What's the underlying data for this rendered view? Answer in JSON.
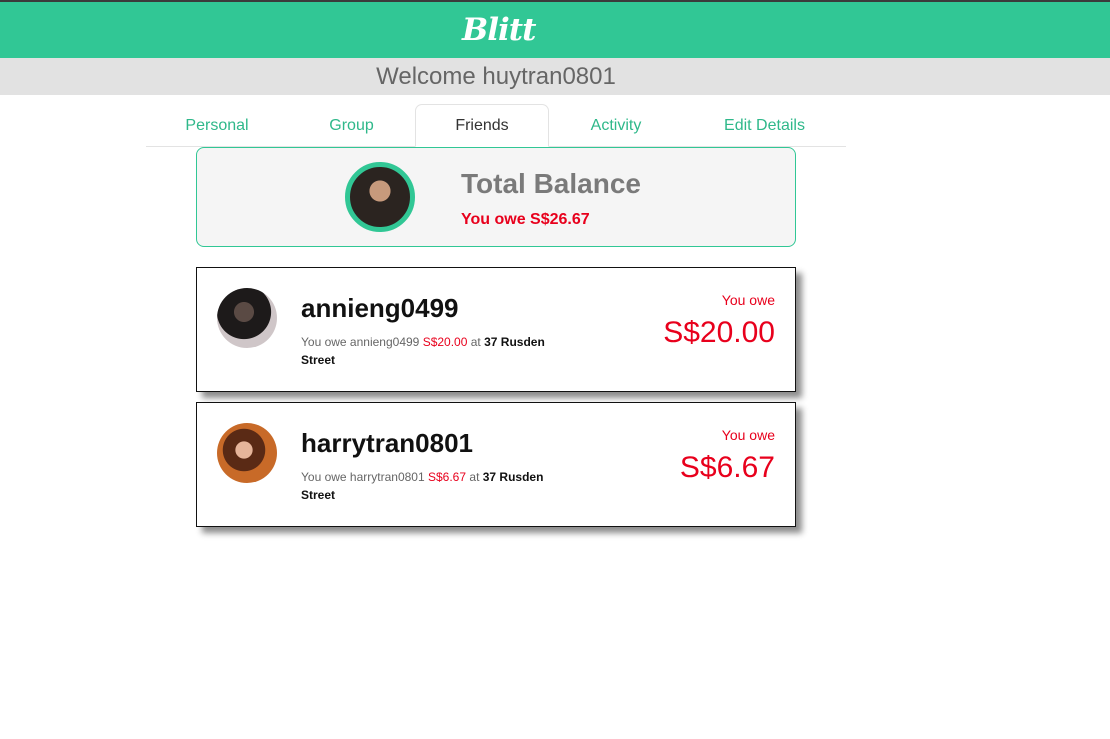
{
  "header": {
    "logo": "Blitt",
    "accent_color": "#31c795"
  },
  "welcome": {
    "text": "Welcome huytran0801"
  },
  "tabs": [
    {
      "label": "Personal",
      "active": false
    },
    {
      "label": "Group",
      "active": false
    },
    {
      "label": "Friends",
      "active": true
    },
    {
      "label": "Activity",
      "active": false
    },
    {
      "label": "Edit Details",
      "active": false
    }
  ],
  "balance": {
    "title": "Total Balance",
    "summary": "You owe S$26.67",
    "avatar_icon": "user-avatar"
  },
  "friends": [
    {
      "name": "annieng0499",
      "desc_prefix": "You owe annieng0499",
      "desc_amount": "S$20.00",
      "desc_at": "at",
      "desc_location": "37 Rusden Street",
      "owe_label": "You owe",
      "owe_amount": "S$20.00"
    },
    {
      "name": "harrytran0801",
      "desc_prefix": "You owe harrytran0801",
      "desc_amount": "S$6.67",
      "desc_at": "at",
      "desc_location": "37 Rusden Street",
      "owe_label": "You owe",
      "owe_amount": "S$6.67"
    }
  ],
  "colors": {
    "owe": "#e8001c",
    "brand": "#31c795"
  }
}
